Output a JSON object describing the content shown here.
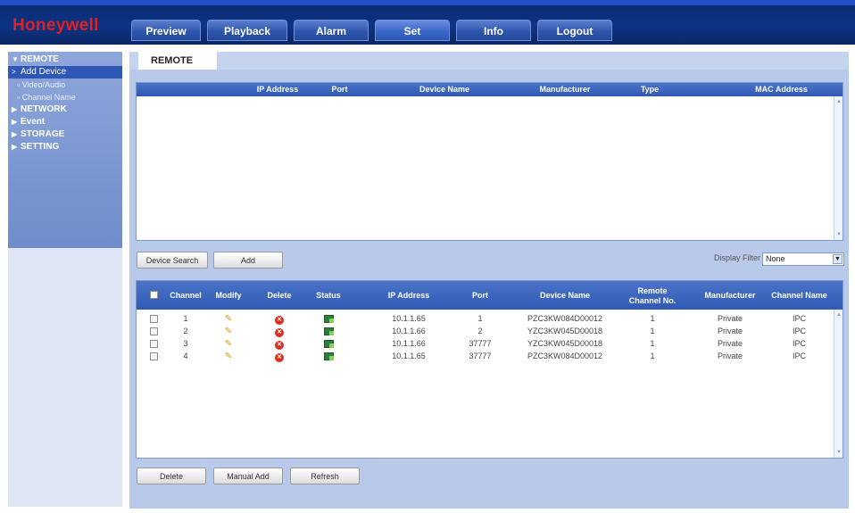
{
  "brand": {
    "logo_text": "Honeywell",
    "logo_color": "#e02020"
  },
  "nav": {
    "tabs": [
      {
        "label": "Preview"
      },
      {
        "label": "Playback"
      },
      {
        "label": "Alarm"
      },
      {
        "label": "Set",
        "active": true
      },
      {
        "label": "Info"
      },
      {
        "label": "Logout"
      }
    ]
  },
  "sidebar": {
    "items": [
      {
        "label": "REMOTE",
        "icon": "triangle-down-icon"
      },
      {
        "label": "Add Device",
        "icon": "chevron-right-icon",
        "selected": true
      },
      {
        "label": "Video/Audio"
      },
      {
        "label": "Channel Name"
      },
      {
        "label": "NETWORK",
        "icon": "triangle-right-icon"
      },
      {
        "label": "Event",
        "icon": "triangle-right-icon"
      },
      {
        "label": "STORAGE",
        "icon": "triangle-right-icon"
      },
      {
        "label": "SETTING",
        "icon": "triangle-right-icon"
      }
    ]
  },
  "main": {
    "tab_label": "REMOTE",
    "search_table": {
      "columns": [
        "IP Address",
        "Port",
        "Device Name",
        "Manufacturer",
        "Type",
        "MAC Address"
      ]
    },
    "buttons": {
      "device_search": "Device Search",
      "add": "Add"
    },
    "display_filter": {
      "label": "Display Filter",
      "value": "None"
    },
    "device_table": {
      "columns": [
        "Channel",
        "Modify",
        "Delete",
        "Status",
        "IP Address",
        "Port",
        "Device Name",
        "Remote Channel No.",
        "Manufacturer",
        "Channel Name"
      ],
      "rows": [
        {
          "channel": "1",
          "ip": "10.1.1.65",
          "port": "1",
          "device": "PZC3KW084D00012",
          "remote": "1",
          "manufacturer": "Private",
          "channel_name": "IPC"
        },
        {
          "channel": "2",
          "ip": "10.1.1.66",
          "port": "2",
          "device": "YZC3KW045D00018",
          "remote": "1",
          "manufacturer": "Private",
          "channel_name": "IPC"
        },
        {
          "channel": "3",
          "ip": "10.1.1.66",
          "port": "37777",
          "device": "YZC3KW045D00018",
          "remote": "1",
          "manufacturer": "Private",
          "channel_name": "IPC"
        },
        {
          "channel": "4",
          "ip": "10.1.1.65",
          "port": "37777",
          "device": "PZC3KW084D00012",
          "remote": "1",
          "manufacturer": "Private",
          "channel_name": "IPC"
        }
      ]
    },
    "bottom_buttons": {
      "delete": "Delete",
      "manual_add": "Manual Add",
      "refresh": "Refresh"
    }
  }
}
